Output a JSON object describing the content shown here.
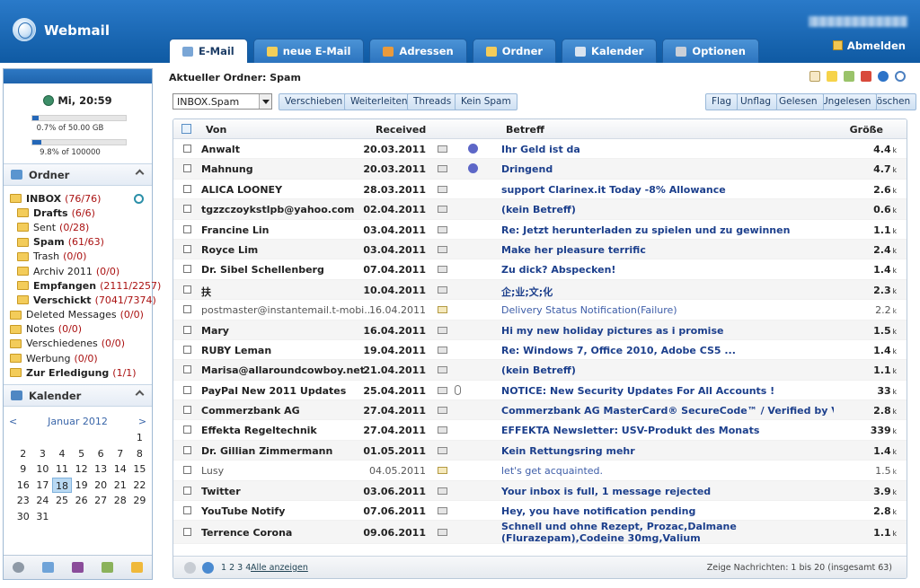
{
  "app": {
    "title": "Webmail",
    "logout": "Abmelden"
  },
  "tabs": [
    {
      "label": "E-Mail",
      "active": true,
      "icon": "mail-icon",
      "color": "#7aa6d6"
    },
    {
      "label": "neue E-Mail",
      "icon": "compose-icon",
      "color": "#f3cf5a"
    },
    {
      "label": "Adressen",
      "icon": "addressbook-icon",
      "color": "#e99a3c"
    },
    {
      "label": "Ordner",
      "icon": "folder-icon",
      "color": "#f3cc5a"
    },
    {
      "label": "Kalender",
      "icon": "calendar-icon",
      "color": "#d8e3f0"
    },
    {
      "label": "Optionen",
      "icon": "gear-icon",
      "color": "#c9cfd8"
    }
  ],
  "sidebar": {
    "clock": "Mi, 20:59",
    "quota": [
      {
        "text": "0.7% of 50.00 GB",
        "fill": 0.07
      },
      {
        "text": "9.8% of 100000",
        "fill": 0.098
      }
    ],
    "folders_title": "Ordner",
    "folders": [
      {
        "name": "INBOX",
        "count": "(76/76)",
        "bold": true,
        "indent": 0
      },
      {
        "name": "Drafts",
        "count": "(6/6)",
        "bold": true,
        "indent": 1
      },
      {
        "name": "Sent",
        "count": "(0/28)",
        "bold": false,
        "indent": 1
      },
      {
        "name": "Spam",
        "count": "(61/63)",
        "bold": true,
        "indent": 1
      },
      {
        "name": "Trash",
        "count": "(0/0)",
        "bold": false,
        "indent": 1
      },
      {
        "name": "Archiv 2011",
        "count": "(0/0)",
        "bold": false,
        "indent": 1
      },
      {
        "name": "Empfangen",
        "count": "(2111/2257)",
        "bold": true,
        "indent": 1
      },
      {
        "name": "Verschickt",
        "count": "(7041/7374)",
        "bold": true,
        "indent": 1
      },
      {
        "name": "Deleted Messages",
        "count": "(0/0)",
        "bold": false,
        "indent": 0
      },
      {
        "name": "Notes",
        "count": "(0/0)",
        "bold": false,
        "indent": 0
      },
      {
        "name": "Verschiedenes",
        "count": "(0/0)",
        "bold": false,
        "indent": 0
      },
      {
        "name": "Werbung",
        "count": "(0/0)",
        "bold": false,
        "indent": 0
      },
      {
        "name": "Zur Erledigung",
        "count": "(1/1)",
        "bold": true,
        "indent": 0
      }
    ],
    "calendar_title": "Kalender",
    "calendar": {
      "prev": "<",
      "month": "Januar 2012",
      "next": ">",
      "today": "18",
      "days": [
        "",
        "",
        "",
        "",
        "",
        "",
        "1",
        "2",
        "3",
        "4",
        "5",
        "6",
        "7",
        "8",
        "9",
        "10",
        "11",
        "12",
        "13",
        "14",
        "15",
        "16",
        "17",
        "18",
        "19",
        "20",
        "21",
        "22",
        "23",
        "24",
        "25",
        "26",
        "27",
        "28",
        "29",
        "30",
        "31"
      ]
    }
  },
  "main": {
    "folder_label": "Aktueller Ordner: Spam",
    "select_value": "INBOX.Spam",
    "actions_left": [
      "Verschieben",
      "Weiterleiten",
      "Threads",
      "Kein Spam"
    ],
    "actions_right": [
      "Flag",
      "Unflag",
      "Gelesen",
      "Ungelesen",
      "Löschen"
    ],
    "columns": {
      "from": "Von",
      "date": "Received",
      "subject": "Betreff",
      "size": "Größe"
    },
    "messages": [
      {
        "from": "Anwalt",
        "date": "20.03.2011",
        "subject": "Ihr Geld ist da",
        "size": "4.4",
        "unit": "k",
        "read": false,
        "imp": true
      },
      {
        "from": "Mahnung",
        "date": "20.03.2011",
        "subject": "Dringend",
        "size": "4.7",
        "unit": "k",
        "read": false,
        "imp": true
      },
      {
        "from": "ALICA LOONEY",
        "date": "28.03.2011",
        "subject": "support Clarinex.it Today -8% Allowance",
        "size": "2.6",
        "unit": "k",
        "read": false
      },
      {
        "from": "tgzzczoykstlpb@yahoo.com",
        "date": "02.04.2011",
        "subject": "(kein Betreff)",
        "size": "0.6",
        "unit": "k",
        "read": false
      },
      {
        "from": "Francine Lin",
        "date": "03.04.2011",
        "subject": "Re: Jetzt herunterladen zu spielen und zu gewinnen",
        "size": "1.1",
        "unit": "k",
        "read": false
      },
      {
        "from": "Royce Lim",
        "date": "03.04.2011",
        "subject": "Make her pleasure terrific",
        "size": "2.4",
        "unit": "k",
        "read": false
      },
      {
        "from": "Dr. Sibel Schellenberg",
        "date": "07.04.2011",
        "subject": "Zu dick? Abspecken!",
        "size": "1.4",
        "unit": "k",
        "read": false
      },
      {
        "from": "扶",
        "date": "10.04.2011",
        "subject": "企;业;文;化",
        "size": "2.3",
        "unit": "k",
        "read": false
      },
      {
        "from": "postmaster@instantemail.t-mobi...",
        "date": "16.04.2011",
        "subject": "Delivery Status Notification(Failure)",
        "size": "2.2",
        "unit": "k",
        "read": true
      },
      {
        "from": "Mary",
        "date": "16.04.2011",
        "subject": "Hi my new holiday pictures as i promise",
        "size": "1.5",
        "unit": "k",
        "read": false
      },
      {
        "from": "RUBY Leman",
        "date": "19.04.2011",
        "subject": "Re: Windows 7, Office 2010, Adobe CS5 ...",
        "size": "1.4",
        "unit": "k",
        "read": false
      },
      {
        "from": "Marisa@allaroundcowboy.net",
        "date": "21.04.2011",
        "subject": "(kein Betreff)",
        "size": "1.1",
        "unit": "k",
        "read": false
      },
      {
        "from": "PayPal New 2011 Updates",
        "date": "25.04.2011",
        "subject": "NOTICE: New Security Updates For All Accounts !",
        "size": "33",
        "unit": "k",
        "read": false,
        "att": true
      },
      {
        "from": "Commerzbank AG",
        "date": "27.04.2011",
        "subject": "Commerzbank AG MasterCard® SecureCode™ / Verified by Visa",
        "size": "2.8",
        "unit": "k",
        "read": false
      },
      {
        "from": "Effekta Regeltechnik",
        "date": "27.04.2011",
        "subject": "EFFEKTA Newsletter: USV-Produkt des Monats",
        "size": "339",
        "unit": "k",
        "read": false
      },
      {
        "from": "Dr. Gillian Zimmermann",
        "date": "01.05.2011",
        "subject": "Kein Rettungsring mehr",
        "size": "1.4",
        "unit": "k",
        "read": false
      },
      {
        "from": "Lusy",
        "date": "04.05.2011",
        "subject": "let's get acquainted.",
        "size": "1.5",
        "unit": "k",
        "read": true
      },
      {
        "from": "Twitter",
        "date": "03.06.2011",
        "subject": "Your inbox is full, 1 message rejected",
        "size": "3.9",
        "unit": "k",
        "read": false
      },
      {
        "from": "YouTube Notify",
        "date": "07.06.2011",
        "subject": "Hey, you have notification pending",
        "size": "2.8",
        "unit": "k",
        "read": false
      },
      {
        "from": "Terrence Corona",
        "date": "09.06.2011",
        "subject": "Schnell und ohne Rezept, Prozac,Dalmane (Flurazepam),Codeine 30mg,Valium",
        "size": "1.1",
        "unit": "k",
        "read": false,
        "tall": true
      }
    ],
    "footer": {
      "pages": "1 2 3 4",
      "all": "Alle anzeigen",
      "count": "Zeige Nachrichten: 1 bis 20 (insgesamt 63)"
    }
  }
}
